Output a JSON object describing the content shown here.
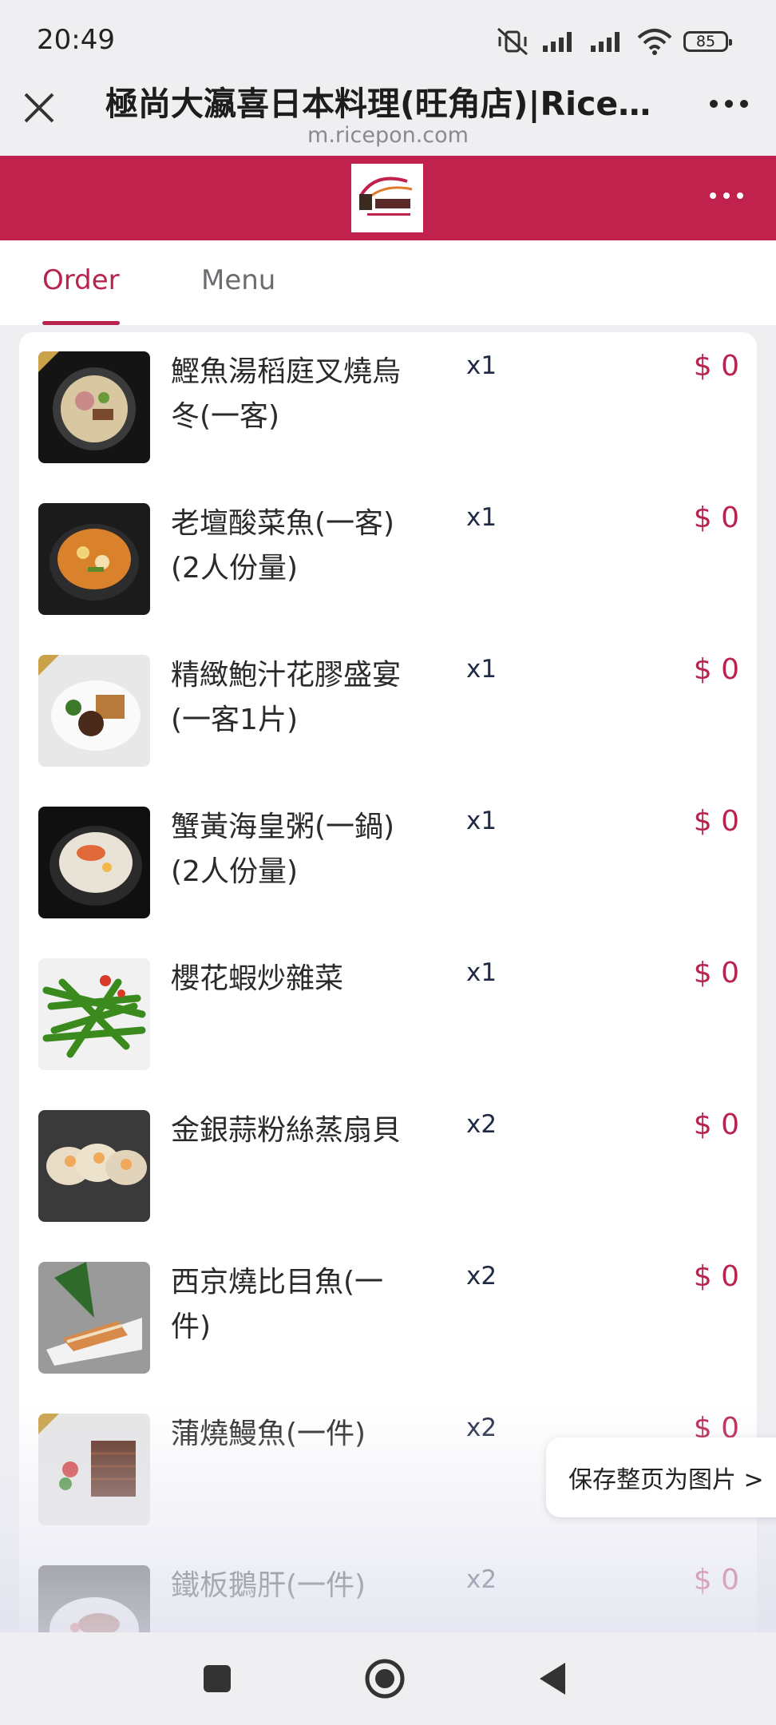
{
  "status_bar": {
    "time": "20:49",
    "battery": "85",
    "icons": [
      "mute-vibrate-icon",
      "signal-icon",
      "signal-icon",
      "wifi-icon",
      "battery-icon"
    ]
  },
  "browser": {
    "title": "極尚大瀛喜日本料理(旺角店)|Ricepo...",
    "url": "m.ricepon.com"
  },
  "tabs": [
    {
      "label": "Order",
      "active": true
    },
    {
      "label": "Menu",
      "active": false
    }
  ],
  "colors": {
    "accent": "#c0224d",
    "price": "#b8244d"
  },
  "items": [
    {
      "name": "鰹魚湯稻庭叉燒烏冬(一客)",
      "qty": "x1",
      "price": "$ 0"
    },
    {
      "name": "老壇酸菜魚(一客)(2人份量)",
      "qty": "x1",
      "price": "$ 0"
    },
    {
      "name": "精緻鮑汁花膠盛宴(一客1片)",
      "qty": "x1",
      "price": "$ 0"
    },
    {
      "name": "蟹黃海皇粥(一鍋)(2人份量)",
      "qty": "x1",
      "price": "$ 0"
    },
    {
      "name": "櫻花蝦炒雜菜",
      "qty": "x1",
      "price": "$ 0"
    },
    {
      "name": "金銀蒜粉絲蒸扇貝",
      "qty": "x2",
      "price": "$ 0"
    },
    {
      "name": "西京燒比目魚(一件)",
      "qty": "x2",
      "price": "$ 0"
    },
    {
      "name": "蒲燒鰻魚(一件)",
      "qty": "x2",
      "price": "$ 0"
    },
    {
      "name": "鐵板鵝肝(一件)",
      "qty": "x2",
      "price": "$ 0"
    }
  ],
  "save_page_label": "保存整页为图片 >"
}
